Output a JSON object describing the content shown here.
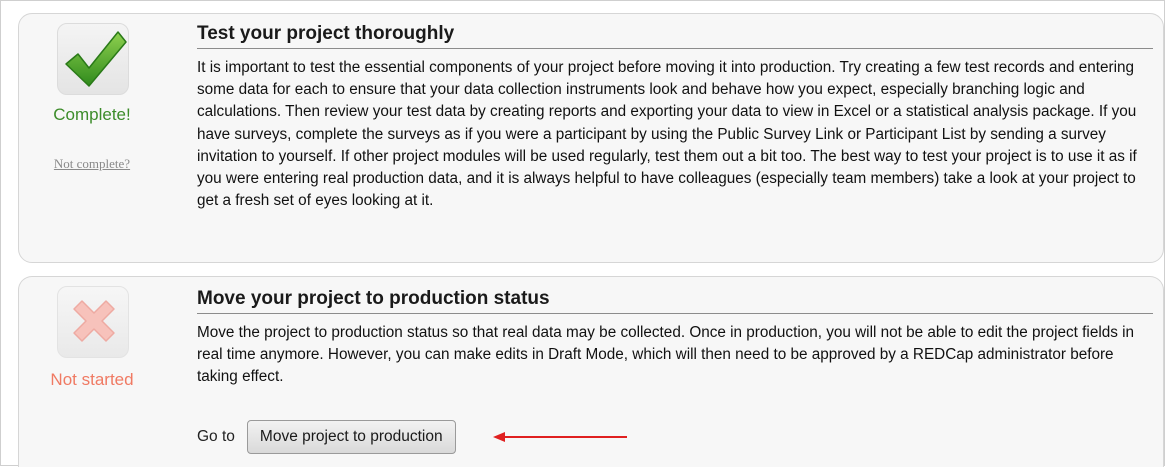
{
  "steps": [
    {
      "status": "complete",
      "status_label": "Complete!",
      "undo_link": "Not complete?",
      "title": "Test your project thoroughly",
      "description": "It is important to test the essential components of your project before moving it into production. Try creating a few test records and entering some data for each to ensure that your data collection instruments look and behave how you expect, especially branching logic and calculations. Then review your test data by creating reports and exporting your data to view in Excel or a statistical analysis package. If you have surveys, complete the surveys as if you were a participant by using the Public Survey Link or Participant List by sending a survey invitation to yourself. If other project modules will be used regularly, test them out a bit too. The best way to test your project is to use it as if you were entering real production data, and it is always helpful to have colleagues (especially team members) take a look at your project to get a fresh set of eyes looking at it."
    },
    {
      "status": "not-started",
      "status_label": "Not started",
      "title": "Move your project to production status",
      "description": "Move the project to production status so that real data may be collected. Once in production, you will not be able to edit the project fields in real time anymore. However, you can make edits in Draft Mode, which will then need to be approved by a REDCap administrator before taking effect.",
      "goto_label": "Go to",
      "button_label": "Move project to production"
    }
  ],
  "colors": {
    "complete": "#3c8c2a",
    "not_started": "#f07a63",
    "annotation_arrow": "#e02020"
  },
  "icons": [
    "checkmark-icon",
    "x-mark-icon",
    "arrow-left-icon"
  ]
}
